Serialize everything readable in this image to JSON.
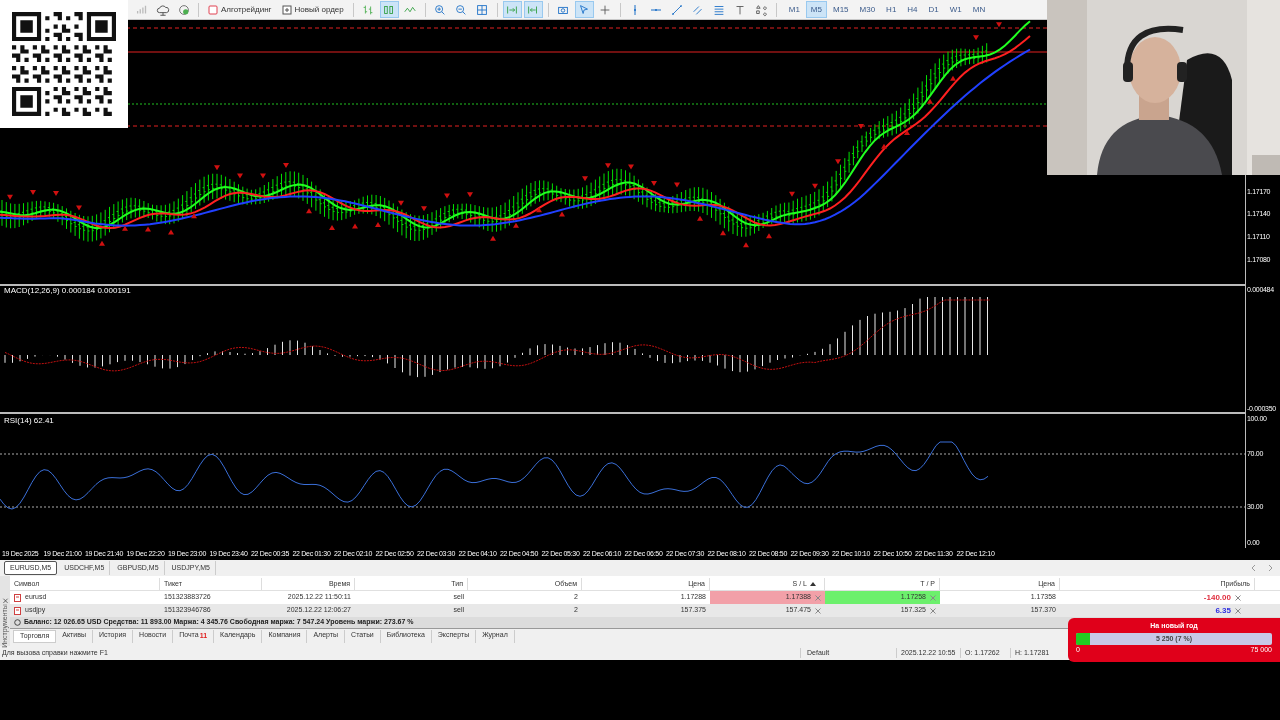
{
  "toolbar": [
    {
      "kind": "signal",
      "selected": false
    },
    {
      "kind": "cloud",
      "selected": false
    },
    {
      "kind": "market",
      "selected": false
    },
    {
      "kind": "separator"
    },
    {
      "kind": "algo",
      "label": "Алготрейдинг",
      "selected": false
    },
    {
      "kind": "order",
      "label": "Новый ордер",
      "selected": false
    },
    {
      "kind": "separator"
    },
    {
      "kind": "bars",
      "selected": false
    },
    {
      "kind": "candles",
      "selected": true
    },
    {
      "kind": "line",
      "selected": false
    },
    {
      "kind": "separator"
    },
    {
      "kind": "zoom-in",
      "selected": false
    },
    {
      "kind": "zoom-out",
      "selected": false
    },
    {
      "kind": "grid",
      "selected": false
    },
    {
      "kind": "separator"
    },
    {
      "kind": "autoscroll",
      "selected": true
    },
    {
      "kind": "shift",
      "selected": true
    },
    {
      "kind": "separator"
    },
    {
      "kind": "screenshot",
      "selected": false
    },
    {
      "kind": "cursor",
      "selected": true
    },
    {
      "kind": "crosshair",
      "selected": false
    },
    {
      "kind": "separator"
    },
    {
      "kind": "vline",
      "selected": false
    },
    {
      "kind": "hline",
      "selected": false
    },
    {
      "kind": "trendline",
      "selected": false
    },
    {
      "kind": "channel",
      "selected": false
    },
    {
      "kind": "fibo",
      "selected": false
    },
    {
      "kind": "text",
      "selected": false
    },
    {
      "kind": "shapes",
      "selected": false
    },
    {
      "kind": "separator"
    }
  ],
  "timeframes": [
    {
      "label": "M1",
      "selected": false
    },
    {
      "label": "M5",
      "selected": true
    },
    {
      "label": "M15",
      "selected": false
    },
    {
      "label": "M30",
      "selected": false
    },
    {
      "label": "H1",
      "selected": false
    },
    {
      "label": "H4",
      "selected": false
    },
    {
      "label": "D1",
      "selected": false
    },
    {
      "label": "W1",
      "selected": false
    },
    {
      "label": "MN",
      "selected": false
    }
  ],
  "price_axis": [
    "1.17170",
    "1.17140",
    "1.17110",
    "1.17080"
  ],
  "macd": {
    "title": "MACD(12,26,9) 0.000184 0.000191",
    "axis": [
      "0.000484",
      "-0.000350"
    ]
  },
  "rsi": {
    "title": "RSI(14) 62.41",
    "axis": [
      "100.00",
      "70.00",
      "30.00",
      "0.00"
    ]
  },
  "time_axis": [
    "19 Dec 2025",
    "19 Dec 21:00",
    "19 Dec 21:40",
    "19 Dec 22:20",
    "19 Dec 23:00",
    "19 Dec 23:40",
    "22 Dec 00:35",
    "22 Dec 01:30",
    "22 Dec 02:10",
    "22 Dec 02:50",
    "22 Dec 03:30",
    "22 Dec 04:10",
    "22 Dec 04:50",
    "22 Dec 05:30",
    "22 Dec 06:10",
    "22 Dec 06:50",
    "22 Dec 07:30",
    "22 Dec 08:10",
    "22 Dec 08:50",
    "22 Dec 09:30",
    "22 Dec 10:10",
    "22 Dec 10:50",
    "22 Dec 11:30",
    "22 Dec 12:10"
  ],
  "chart_tabs": [
    {
      "label": "EURUSD,M5",
      "selected": true
    },
    {
      "label": "USDCHF,M5",
      "selected": false
    },
    {
      "label": "GBPUSD,M5",
      "selected": false
    },
    {
      "label": "USDJPY,M5",
      "selected": false
    }
  ],
  "panel_label": "Инструменты",
  "trade_table": {
    "columns": [
      "Символ",
      "Тикет",
      "Время",
      "Тип",
      "Объем",
      "Цена",
      "S / L",
      "T / P",
      "Цена",
      "Прибыль"
    ],
    "rows": [
      {
        "cells": [
          "eurusd",
          "151323883726",
          "2025.12.22 11:50:11",
          "sell",
          "2",
          "1.17288",
          "1.17388",
          "1.17258",
          "1.17358",
          "-140.00"
        ],
        "selected": false,
        "sl_alert": true,
        "tp_alert": true,
        "color": "#e03040"
      },
      {
        "cells": [
          "usdjpy",
          "151323946786",
          "2025.12.22 12:06:27",
          "sell",
          "2",
          "157.375",
          "157.475",
          "157.325",
          "157.370",
          "6.35"
        ],
        "selected": true,
        "sl_alert": false,
        "tp_alert": false,
        "color": "#3030e0"
      }
    ]
  },
  "balance_line": "Баланс: 12 026.65 USD  Средства: 11 893.00  Маржа: 4 345.76  Свободная маржа: 7 547.24  Уровень маржи: 273.67 %",
  "bottom_tabs": [
    {
      "label": "Торговля",
      "selected": true
    },
    {
      "label": "Активы",
      "selected": false
    },
    {
      "label": "История",
      "selected": false
    },
    {
      "label": "Новости",
      "selected": false
    },
    {
      "label": "Почта",
      "badge": "11",
      "selected": false
    },
    {
      "label": "Календарь",
      "selected": false
    },
    {
      "label": "Компания",
      "selected": false
    },
    {
      "label": "Алерты",
      "selected": false
    },
    {
      "label": "Статьи",
      "selected": false
    },
    {
      "label": "Библиотека",
      "selected": false
    },
    {
      "label": "Эксперты",
      "selected": false
    },
    {
      "label": "Журнал",
      "selected": false
    }
  ],
  "status_bar": {
    "help": "Для вызова справки нажмите F1",
    "profile": "Default",
    "time": "2025.12.22 10:55",
    "open": "O: 1.17262",
    "high": "H: 1.17281"
  },
  "goal_widget": {
    "title": "На новый год",
    "progress": "5 250 (7 %)",
    "level": 0.07,
    "min": "0",
    "max": "75 000"
  }
}
